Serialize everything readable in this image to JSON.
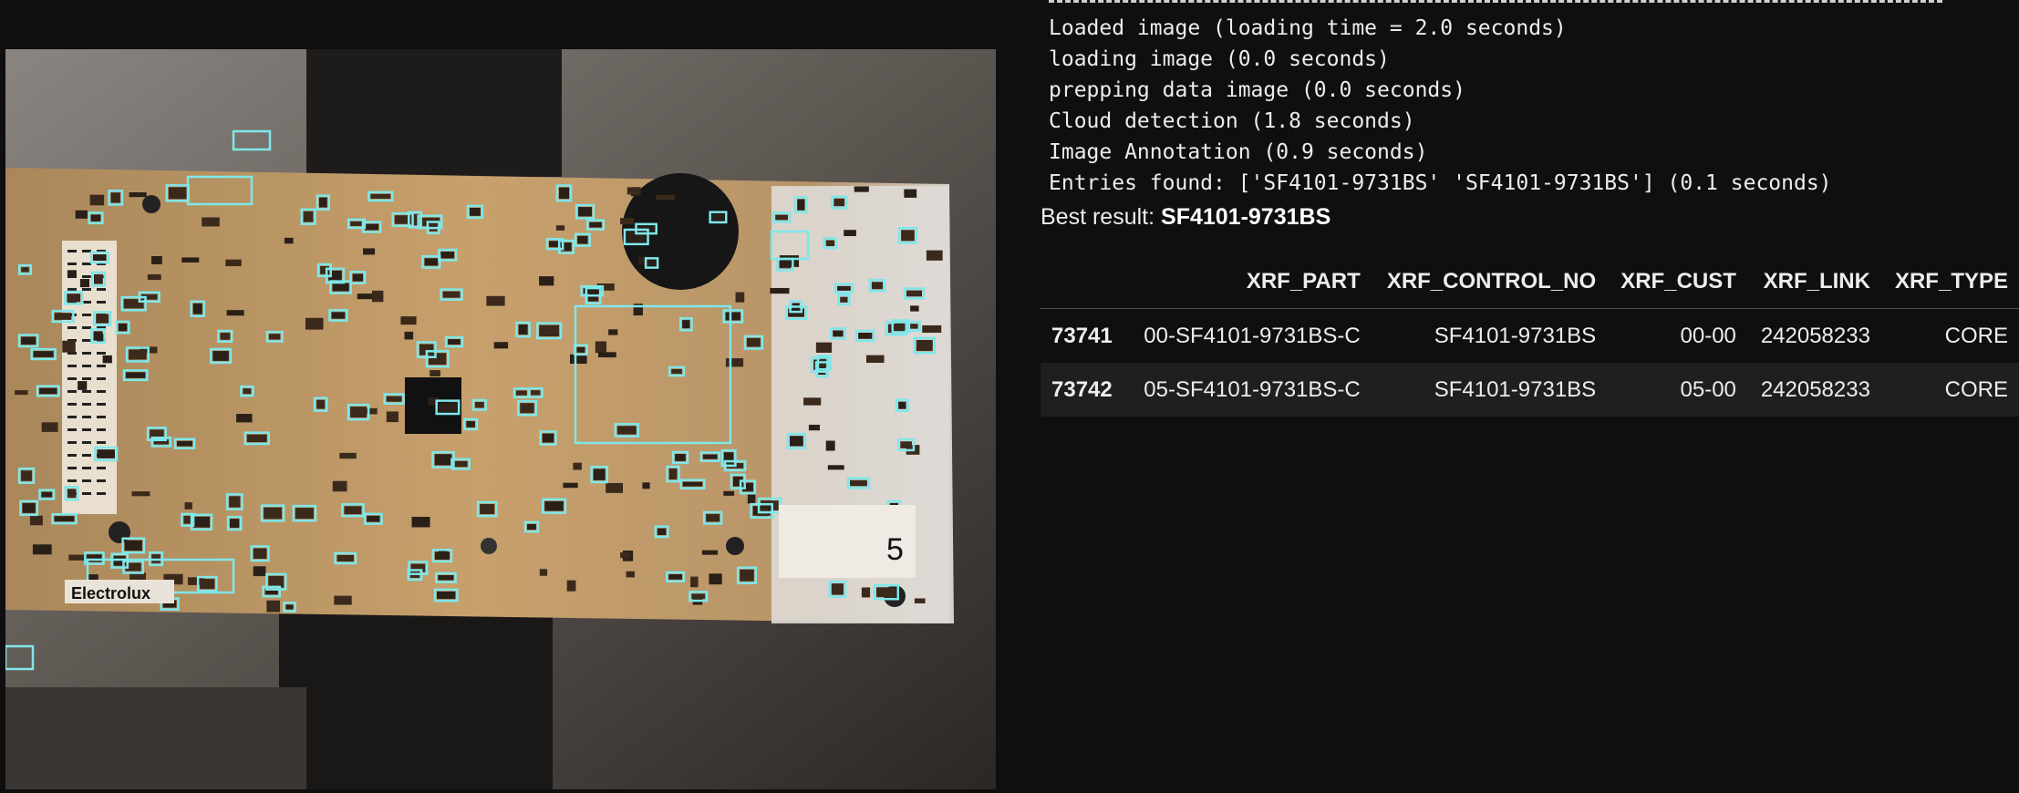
{
  "photo": {
    "subject": "annotated-circuit-board",
    "board_logo_text": "Electrolux",
    "board_number_text": "5",
    "box_color": "#7fe7ea"
  },
  "log": {
    "lines": [
      "Loaded image (loading time = 2.0 seconds)",
      "loading image (0.0 seconds)",
      "prepping data image (0.0 seconds)",
      "Cloud detection (1.8 seconds)",
      "Image Annotation (0.9 seconds)",
      "Entries found: ['SF4101-9731BS' 'SF4101-9731BS'] (0.1 seconds)"
    ]
  },
  "best": {
    "label": "Best result:",
    "value": "SF4101-9731BS"
  },
  "table": {
    "columns": [
      "",
      "XRF_PART",
      "XRF_CONTROL_NO",
      "XRF_CUST",
      "XRF_LINK",
      "XRF_TYPE"
    ],
    "rows": [
      [
        "73741",
        "00-SF4101-9731BS-C",
        "SF4101-9731BS",
        "00-00",
        "242058233",
        "CORE"
      ],
      [
        "73742",
        "05-SF4101-9731BS-C",
        "SF4101-9731BS",
        "05-00",
        "242058233",
        "CORE"
      ]
    ]
  },
  "colors": {
    "background": "#0f0f10",
    "text": "#ededed",
    "row_alt": "#1f1f1f",
    "annotation": "#7fe7ea"
  }
}
